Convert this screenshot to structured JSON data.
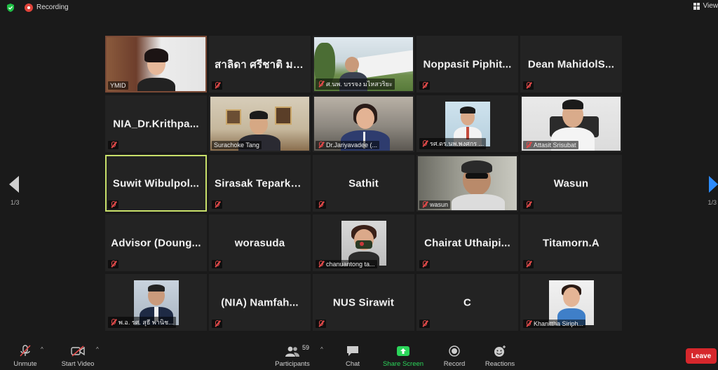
{
  "topbar": {
    "recording_label": "Recording",
    "view_label": "View",
    "colors": {
      "shield": "#1fbf45",
      "record": "#e0433a"
    }
  },
  "pagination": {
    "left_label": "1/3",
    "right_label": "1/3"
  },
  "tiles": [
    {
      "type": "video",
      "label": "YMID",
      "muted": false
    },
    {
      "type": "name",
      "name": "สาลิดา ศรีชาติ ม....",
      "muted": true
    },
    {
      "type": "video",
      "label": "ศ.นพ. บรรจง มไหสวริยะ",
      "muted": true
    },
    {
      "type": "name",
      "name": "Noppasit Piphit...",
      "muted": true
    },
    {
      "type": "name",
      "name": "Dean MahidolS...",
      "muted": true
    },
    {
      "type": "name",
      "name": "NIA_Dr.Krithpa...",
      "muted": true
    },
    {
      "type": "video",
      "label": "Surachoke Tang",
      "muted": false
    },
    {
      "type": "video",
      "label": "Dr.Jariyavadee (...",
      "muted": true
    },
    {
      "type": "photo",
      "label": "รศ.ดร.นพ.พงศกร ...",
      "muted": true
    },
    {
      "type": "video",
      "label": "Attasit Srisubat",
      "muted": true
    },
    {
      "type": "name",
      "name": "Suwit Wibulpol...",
      "muted": true,
      "active": true
    },
    {
      "type": "name",
      "name": "Sirasak Teparkum",
      "muted": true
    },
    {
      "type": "name",
      "name": "Sathit",
      "muted": true
    },
    {
      "type": "video",
      "label": "wasun",
      "muted": true
    },
    {
      "type": "name",
      "name": "Wasun",
      "muted": true
    },
    {
      "type": "name",
      "name": "Advisor (Doung...",
      "muted": true
    },
    {
      "type": "name",
      "name": "worasuda",
      "muted": true
    },
    {
      "type": "photo",
      "label": "chanuantong ta...",
      "muted": true
    },
    {
      "type": "name",
      "name": "Chairat Uthaipi...",
      "muted": true
    },
    {
      "type": "name",
      "name": "Titamorn.A",
      "muted": true
    },
    {
      "type": "photo",
      "label": "พ.อ. รศ. สุธี พานิช...",
      "muted": true
    },
    {
      "type": "name",
      "name": "(NIA) Namfah...",
      "muted": true
    },
    {
      "type": "name",
      "name": "NUS Sirawit",
      "muted": true
    },
    {
      "type": "name",
      "name": "C",
      "muted": true
    },
    {
      "type": "photo",
      "label": "Khanittha Siriph...",
      "muted": true
    }
  ],
  "toolbar": {
    "unmute_label": "Unmute",
    "start_video_label": "Start Video",
    "participants_label": "Participants",
    "participants_count": "59",
    "chat_label": "Chat",
    "share_screen_label": "Share Screen",
    "record_label": "Record",
    "reactions_label": "Reactions",
    "leave_label": "Leave",
    "colors": {
      "share": "#2bd65a",
      "leave": "#d6272c",
      "mute_slash": "#e24a4a"
    }
  }
}
